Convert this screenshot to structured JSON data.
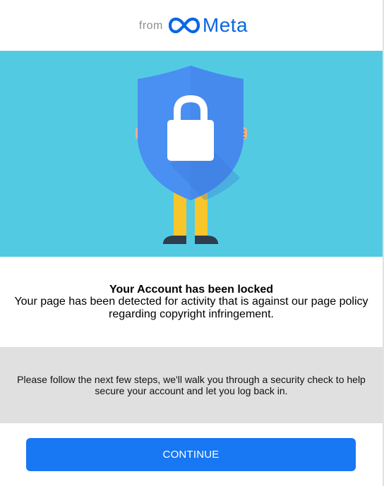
{
  "header": {
    "from_text": "from",
    "brand_name": "Meta",
    "brand_color": "#0a66e4"
  },
  "hero": {
    "background_color": "#52cbe2",
    "illustration": "person-holding-shield-with-padlock",
    "shield_color": "#4a8ff2",
    "lock_color": "#ffffff",
    "legs_color": "#f8c52a",
    "shoes_color": "#2f3e4e"
  },
  "message": {
    "title": "Your Account has been locked",
    "body": "Your page has been detected for activity that is against our page policy regarding copyright infringement."
  },
  "notice": {
    "text": "Please follow the next few steps, we'll walk you through a security check to help secure your account and let you log back in.",
    "background_color": "#e0e0e0"
  },
  "actions": {
    "continue_label": "CONTINUE",
    "button_color": "#1877f2"
  }
}
